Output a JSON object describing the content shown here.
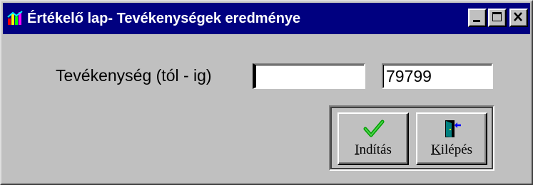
{
  "window": {
    "title": "Értékelő lap- Tevékenységek eredménye",
    "title_bar_color": "#000080",
    "face_color": "#c0c0c0",
    "app_icon": "colorful-app-icon",
    "controls": {
      "minimize_icon": "minimize-icon",
      "maximize_icon": "maximize-icon",
      "close_icon": "close-icon"
    }
  },
  "form": {
    "range_label": "Tevékenység (tól - ig)",
    "from_value": "",
    "to_value": "79799"
  },
  "actions": {
    "start": {
      "mnemonic": "I",
      "label_rest": "ndítás",
      "icon": "green-checkmark-icon",
      "icon_color": "#00a000"
    },
    "exit": {
      "mnemonic": "K",
      "label_rest": "ilépés",
      "icon": "exit-door-icon",
      "icon_color": "#008080"
    }
  }
}
